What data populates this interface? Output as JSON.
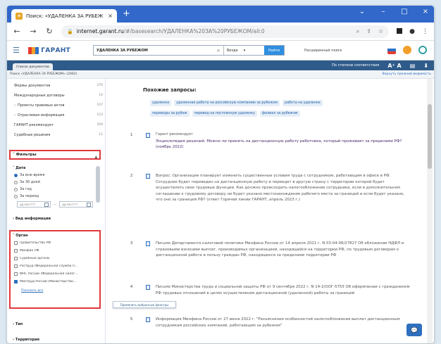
{
  "browser": {
    "tab_title": "Поиск: «УДАЛЕНКА ЗА РУБЕЖ",
    "tab_close": "×",
    "new_tab": "+",
    "url_domain": "internet.garant.ru",
    "url_path": "/#/basesearch/УДАЛЕНКА%20ЗА%20РУБЕЖОМ/all:0",
    "window_controls": [
      "⌄",
      "–",
      "□",
      "×"
    ]
  },
  "app": {
    "logo_text": "ГАРАНТ",
    "search_value": "УДАЛЕНКА ЗА РУБЕЖОМ",
    "search_clear": "×",
    "scope_value": "Везде",
    "find_label": "Найти",
    "advanced_search": "Расширенный поиск",
    "subtab_label": "Список документов",
    "sort_label": "По степени соответствия",
    "font_size_label": "A⁺ A",
    "breadcrumb": "Поиск «УДАЛЕНКА ЗА РУБЕЖОМ» (2002)",
    "breadcrumb_link": "Вернуть прежний видимость"
  },
  "colors": {
    "chrome_blue": "#3168c9",
    "app_navy": "#2f5b8a",
    "highlight_red": "#e0383c",
    "link_blue": "#1f5ea8",
    "search_highlight": "#fdf1a8"
  },
  "sidebar": {
    "categories": [
      {
        "label": "Формы документов",
        "count": "276"
      },
      {
        "label": "Международные договоры",
        "count": "14"
      },
      {
        "label": "Проекты правовых актов",
        "count": "107"
      },
      {
        "label": "Отраслевая информация",
        "count": "123"
      },
      {
        "label": "ГАРАНТ рекомендует",
        "count": "209"
      },
      {
        "label": "Судебные решения",
        "count": "12"
      }
    ],
    "filters_title": "Фильтры",
    "date_title": "Дата",
    "date_options": [
      "За всю время",
      "За 30 дней",
      "За год",
      "За период"
    ],
    "date_from_placeholder": "дд.мм.гггг",
    "date_dash": "—",
    "date_to_placeholder": "дд.мм.гггг",
    "info_type_title": "Вид информации",
    "organ_title": "Орган",
    "organ_options": [
      "Правительство РФ",
      "Минфин РФ",
      "Судебные органы",
      "Роструд (Федеральная служба п...",
      "ФНС России (Федеральная налог...",
      "Минтруд России (Министерство..."
    ],
    "show_all": "Показать все",
    "topic_title": "Тип",
    "territory_title": "Территория",
    "apply_filters_label": "Применить выбранные фильтры"
  },
  "main": {
    "similar_title": "Похожие запросы:",
    "chips_row1": [
      "удаленка",
      "удаленная работа на российскую компанию за рубежом",
      "работа на удаленке"
    ],
    "chips_row2": [
      "переводы за рубеж",
      "перевод на постоянную удаленку",
      "филиал за рубежом"
    ],
    "results": [
      {
        "num": "1",
        "rec": "Гарант рекомендует",
        "text": "Энциклопедия решений. Можно ли принять на дистанционную работу работника, который проживает за пределами РФ? (ноябрь 2022)"
      },
      {
        "num": "2",
        "text": "Вопрос: Организация планирует изменить существенные условия труда с сотрудником, работающим в офисе в РФ. Сотрудник будет переведен на дистанционную работу и переедет в другую страну с территории которой будет осуществлять свои трудовые функции. Как должно происходить налогообложение сотрудника, если в дополнительном соглашении к трудовому договору не будет указано местонахождение рабочего места за границей и если будет указано, что оно за границей РФ? (ответ Горячей линии ГАРАНТ, апрель 2023 г.)"
      },
      {
        "num": "3",
        "text": "Письмо Департамента налоговой политики Минфина России от 14 апреля 2021 г. N 03-04-06/27827 Об обложении НДФЛ и страховыми взносами выплат, производимых организацией, находящейся на территории РФ, по трудовым договорам о дистанционной работе в пользу граждан РФ, находящихся за пределами территории РФ"
      },
      {
        "num": "4",
        "text": "Письмо Министерства труда и социальной защиты РФ от 9 сентября 2022 г. N 14-2/ООГ-5755 Об оформлении с гражданином РФ трудовых отношений в целях осуществления дистанционной (удаленной) работы за границей"
      },
      {
        "num": "5",
        "text": "Информация Минфина России от 27 июня 2022 г. \"Разъяснения особенностей налогообложения выплат дистанционным сотрудникам российских компаний, работающим за рубежом\""
      }
    ]
  }
}
